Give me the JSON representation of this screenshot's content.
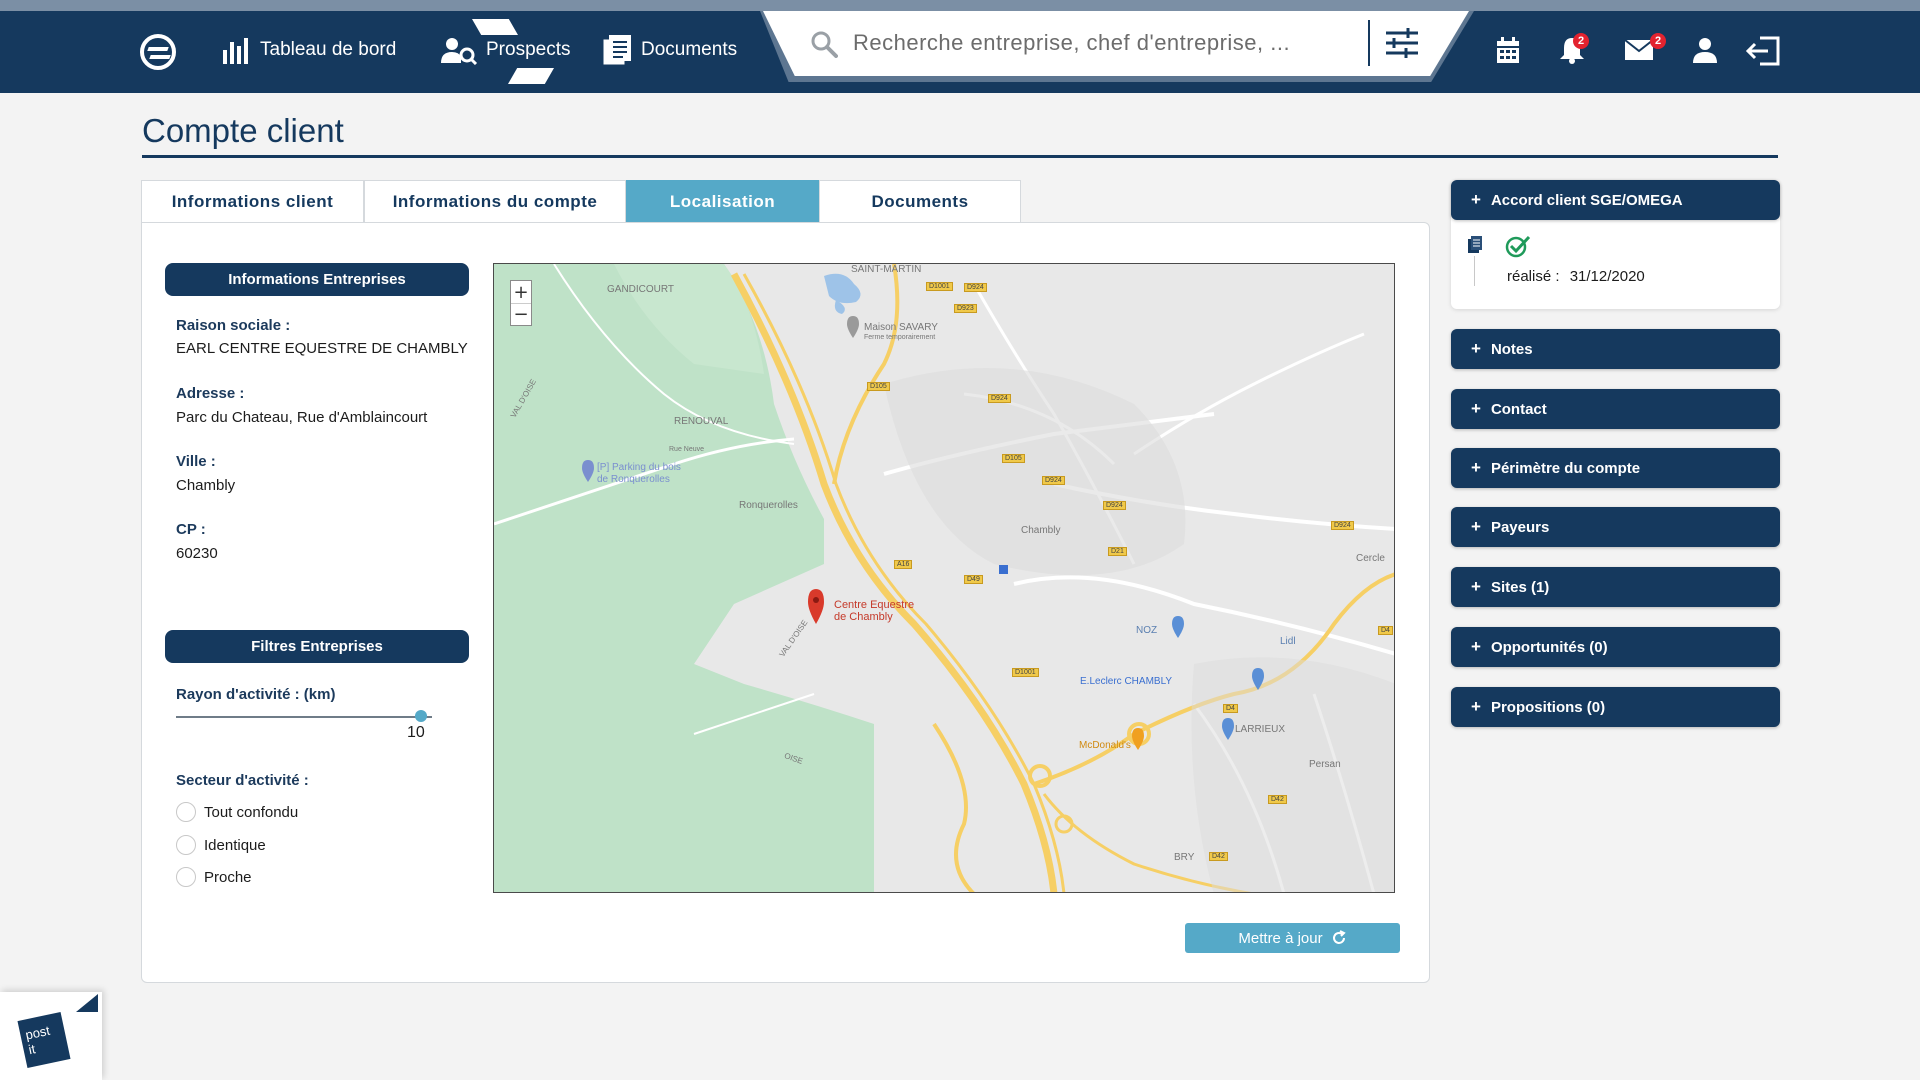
{
  "nav": {
    "items": [
      {
        "label": "Tableau de bord",
        "icon": "bar-chart-icon"
      },
      {
        "label": "Prospects",
        "icon": "users-search-icon"
      },
      {
        "label": "Documents",
        "icon": "documents-icon"
      }
    ],
    "search_placeholder": "Recherche entreprise, chef d'entreprise, ...",
    "notifications_count": "2",
    "messages_count": "2"
  },
  "page": {
    "title": "Compte client"
  },
  "tabs": [
    {
      "label": "Informations client",
      "active": false
    },
    {
      "label": "Informations du compte",
      "active": false
    },
    {
      "label": "Localisation",
      "active": true
    },
    {
      "label": "Documents",
      "active": false
    }
  ],
  "company": {
    "section_title": "Informations Entreprises",
    "raison_label": "Raison sociale :",
    "raison_value": "EARL CENTRE EQUESTRE DE CHAMBLY",
    "adresse_label": "Adresse :",
    "adresse_value": "Parc du Chateau, Rue d'Amblaincourt",
    "ville_label": "Ville :",
    "ville_value": "Chambly",
    "cp_label": "CP :",
    "cp_value": "60230"
  },
  "filters": {
    "section_title": "Filtres Entreprises",
    "rayon_label": "Rayon d'activité : (km)",
    "rayon_value": "10",
    "secteur_label": "Secteur d'activité :",
    "options": [
      "Tout confondu",
      "Identique",
      "Proche"
    ]
  },
  "map": {
    "pin_label_line1": "Centre Equestre",
    "pin_label_line2": "de Chambly",
    "labels": {
      "saint_martin": "SAINT-MARTIN",
      "gandicourt": "GANDICOURT",
      "maison_savary": "Maison SAVARY",
      "maison_savary_sub": "Ferme temporairement",
      "renouval": "RENOUVAL",
      "rue_neuve": "Rue Neuve",
      "parking": "[P] Parking du bois",
      "parking_sub": "de Ronquerolles",
      "ronquerolles": "Ronquerolles",
      "chambly": "Chambly",
      "cercle": "Cercle",
      "noz": "NOZ",
      "lidl": "Lidl",
      "leclerc": "E.Leclerc CHAMBLY",
      "mcdonalds": "McDonald's",
      "larrieux": "LARRIEUX",
      "persan": "Persan",
      "bry": "BRY",
      "val_oise": "VAL D'OISE",
      "oise": "OISE"
    },
    "roads": [
      "D1001",
      "D924",
      "D923",
      "D105",
      "D924",
      "D105",
      "D924",
      "D924",
      "D21",
      "D924",
      "A16",
      "D49",
      "D1001",
      "D4",
      "D4",
      "D42",
      "D42"
    ],
    "zoom_in": "+",
    "zoom_out": "−"
  },
  "update_button": "Mettre à jour",
  "right": {
    "accord_title": "Accord client SGE/OMEGA",
    "accord_status_label": "réalisé :",
    "accord_date": "31/12/2020",
    "sections": [
      "Notes",
      "Contact",
      "Périmètre du compte",
      "Payeurs",
      "Sites (1)",
      "Opportunités (0)",
      "Propositions (0)"
    ]
  },
  "postit": {
    "line1": "post",
    "line2": "it"
  },
  "colors": {
    "navy": "#15395e",
    "accent": "#55a9c8",
    "badge": "#e3232f"
  }
}
